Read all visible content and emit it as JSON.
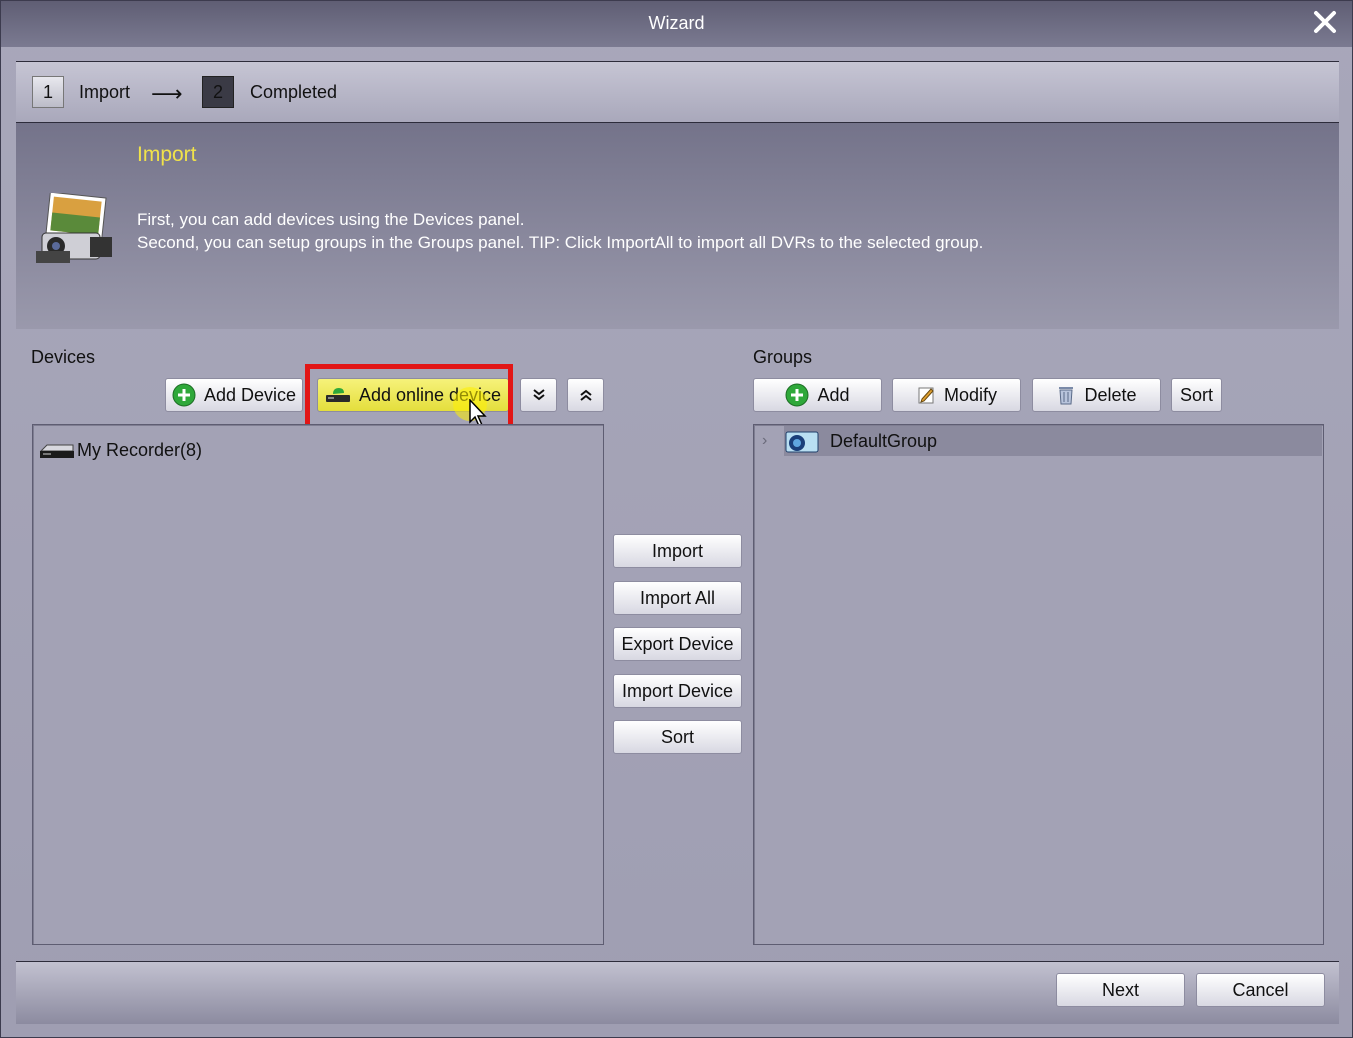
{
  "window": {
    "title": "Wizard",
    "close_icon": "close-icon"
  },
  "steps": [
    {
      "number": "1",
      "label": "Import"
    },
    {
      "number": "2",
      "label": "Completed"
    }
  ],
  "info": {
    "heading": "Import",
    "line1": "First, you can add devices using the Devices panel.",
    "line2": "Second, you can setup groups in the Groups panel. TIP: Click ImportAll to import all DVRs to the selected group."
  },
  "devices": {
    "title": "Devices",
    "buttons": {
      "add_device": "Add Device",
      "add_online_device": "Add online device"
    },
    "items": [
      {
        "label": "My Recorder(8)"
      }
    ]
  },
  "middle_buttons": [
    "Import",
    "Import All",
    "Export Device",
    "Import Device",
    "Sort"
  ],
  "groups": {
    "title": "Groups",
    "buttons": {
      "add": "Add",
      "modify": "Modify",
      "delete": "Delete",
      "sort": "Sort"
    },
    "items": [
      {
        "label": "DefaultGroup"
      }
    ]
  },
  "footer": {
    "next": "Next",
    "cancel": "Cancel"
  },
  "colors": {
    "highlight_box": "#e21616",
    "heading_yellow": "#f0e24a",
    "active_button": "#f0ec5a"
  }
}
